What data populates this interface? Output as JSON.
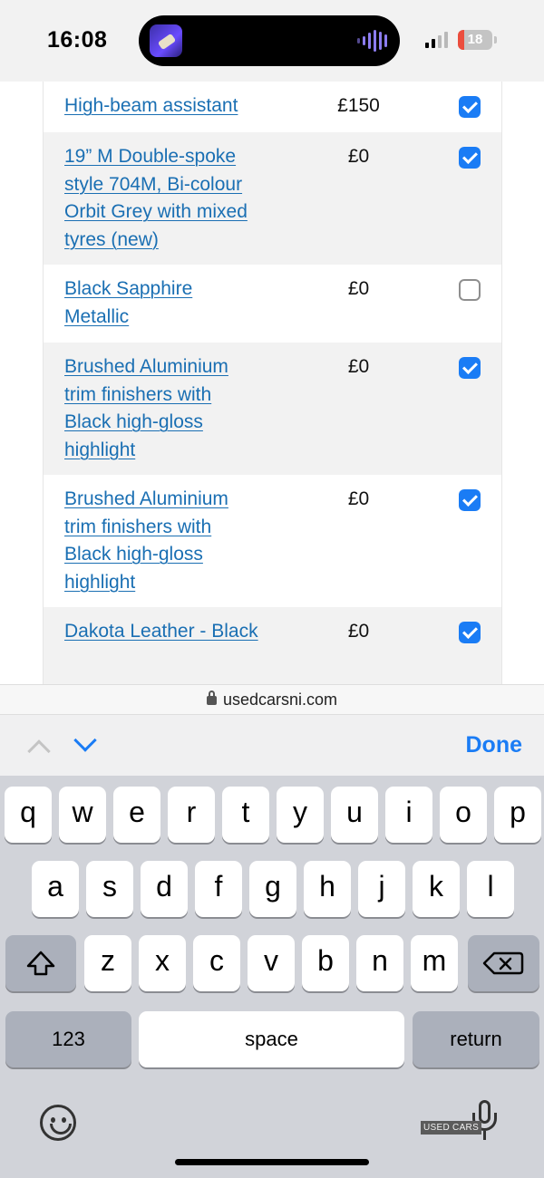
{
  "status_bar": {
    "time": "16:08",
    "battery": "18",
    "battery_level": 0.18
  },
  "options": [
    {
      "name": "High-beam assistant",
      "price": "£150",
      "checked": true,
      "shaded": false
    },
    {
      "name": "19” M Double-spoke style 704M, Bi-colour Orbit Grey with mixed tyres (new)",
      "price": "£0",
      "checked": true,
      "shaded": true
    },
    {
      "name": "Black Sapphire Metallic",
      "price": "£0",
      "checked": false,
      "shaded": false
    },
    {
      "name": "Brushed Aluminium trim finishers with Black high-gloss highlight",
      "price": "£0",
      "checked": true,
      "shaded": true
    },
    {
      "name": "Brushed Aluminium trim finishers with Black high-gloss highlight",
      "price": "£0",
      "checked": true,
      "shaded": false
    },
    {
      "name": "Dakota Leather - Black",
      "price": "£0",
      "checked": true,
      "shaded": true
    }
  ],
  "url_bar": {
    "domain": "usedcarsni.com"
  },
  "accessory_bar": {
    "done_label": "Done"
  },
  "keyboard": {
    "row1": [
      "q",
      "w",
      "e",
      "r",
      "t",
      "y",
      "u",
      "i",
      "o",
      "p"
    ],
    "row2": [
      "a",
      "s",
      "d",
      "f",
      "g",
      "h",
      "j",
      "k",
      "l"
    ],
    "row3": [
      "z",
      "x",
      "c",
      "v",
      "b",
      "n",
      "m"
    ],
    "numbers_label": "123",
    "space_label": "space",
    "return_label": "return"
  },
  "watermark": "USED CARS",
  "icons": {
    "lock": "lock-icon",
    "shift": "shift-icon",
    "delete": "delete-icon",
    "emoji": "emoji-icon",
    "mic": "microphone-icon"
  },
  "colors": {
    "link": "#1a6fb3",
    "accent": "#1a7cf5",
    "battery_low": "#eb4d3d"
  }
}
